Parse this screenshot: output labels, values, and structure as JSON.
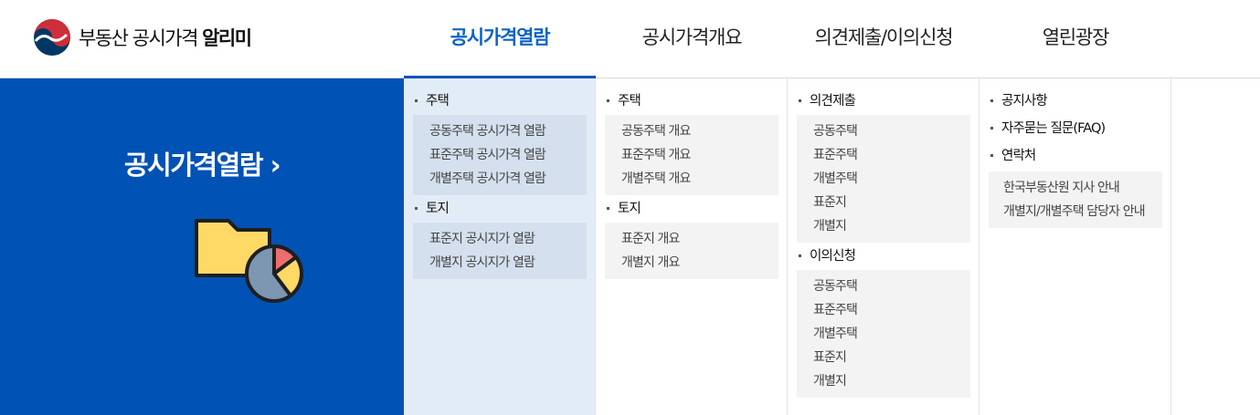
{
  "brand": {
    "name_regular": "부동산 공시가격 ",
    "name_bold": "알리미"
  },
  "gnb": [
    {
      "label": "공시가격열람",
      "active": true
    },
    {
      "label": "공시가격개요",
      "active": false
    },
    {
      "label": "의견제출/이의신청",
      "active": false
    },
    {
      "label": "열린광장",
      "active": false
    }
  ],
  "promo": {
    "title": "공시가격열람 ›"
  },
  "columns": {
    "col1": {
      "s1": {
        "title": "주택",
        "items": [
          "공동주택 공시가격 열람",
          "표준주택 공시가격 열람",
          "개별주택 공시가격 열람"
        ]
      },
      "s2": {
        "title": "토지",
        "items": [
          "표준지 공시지가 열람",
          "개별지 공시지가 열람"
        ]
      }
    },
    "col2": {
      "s1": {
        "title": "주택",
        "items": [
          "공동주택 개요",
          "표준주택 개요",
          "개별주택 개요"
        ]
      },
      "s2": {
        "title": "토지",
        "items": [
          "표준지 개요",
          "개별지 개요"
        ]
      }
    },
    "col3": {
      "s1": {
        "title": "의견제출",
        "items": [
          "공동주택",
          "표준주택",
          "개별주택",
          "표준지",
          "개별지"
        ]
      },
      "s2": {
        "title": "이의신청",
        "items": [
          "공동주택",
          "표준주택",
          "개별주택",
          "표준지",
          "개별지"
        ]
      }
    },
    "col4": {
      "items": [
        "공지사항",
        "자주묻는 질문(FAQ)",
        "연락처"
      ],
      "sub": [
        "한국부동산원 지사 안내",
        "개별지/개별주택 담당자 안내"
      ]
    }
  },
  "colors": {
    "primary_blue": "#0052b4",
    "active_text": "#0a63c8",
    "active_col_bg": "#e1ecf7"
  }
}
